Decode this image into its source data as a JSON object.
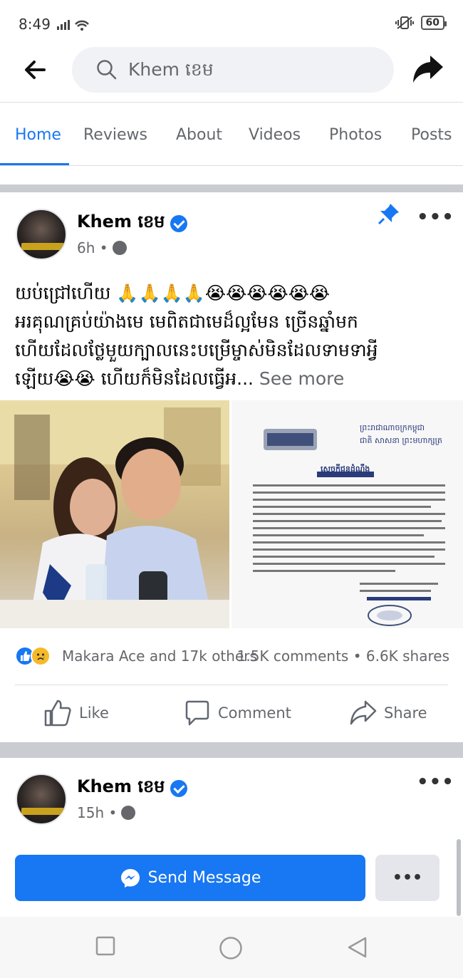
{
  "status_bar": {
    "time": "8:49",
    "battery": "60"
  },
  "search": {
    "query": "Khem ខេម"
  },
  "tabs": [
    {
      "label": "Home"
    },
    {
      "label": "Reviews"
    },
    {
      "label": "About"
    },
    {
      "label": "Videos"
    },
    {
      "label": "Photos"
    },
    {
      "label": "Posts"
    }
  ],
  "post1": {
    "author": "Khem ខេម",
    "time": "6h •",
    "text_line1": "យប់ជ្រៅហើយ 🙏🙏🙏🙏😭😭😭😭😭😭",
    "text_line2": "អរគុណគ្រប់យ៉ាងមេ មេពិតជាមេដ៏ល្អមែន ច្រើនឆ្នាំមក",
    "text_line3": "ហើយដែលថ្លែមួយក្បាលនេះបម្រើម្ចាស់មិនដែលទាមទាអ្វី",
    "text_line4": "ឡើយ😭😭 ហើយក៏មិនដែលធ្វើអ...",
    "see_more": "See more",
    "doc_header1": "ព្រះរាជាណាចក្រកម្ពុជា",
    "doc_header2": "ជាតិ សាសនា ព្រះមហាក្សត្រ",
    "doc_heading": "សេចក្តីជូនដំណឹង",
    "reactions_names": "Makara Ace and 17k others",
    "stats": "1.5K comments • 6.6K shares",
    "like_label": "Like",
    "comment_label": "Comment",
    "share_label": "Share"
  },
  "post2": {
    "author": "Khem ខេម",
    "time": "15h •"
  },
  "cta": {
    "send_message": "Send Message",
    "more": "•••"
  },
  "icons": {
    "back": "arrow-left",
    "search": "magnifier",
    "share": "share-arrow",
    "pin": "pin",
    "globe": "globe",
    "messenger": "messenger"
  },
  "colors": {
    "accent": "#1877f2",
    "muted": "#65676b",
    "separator": "#c9ccd1"
  }
}
